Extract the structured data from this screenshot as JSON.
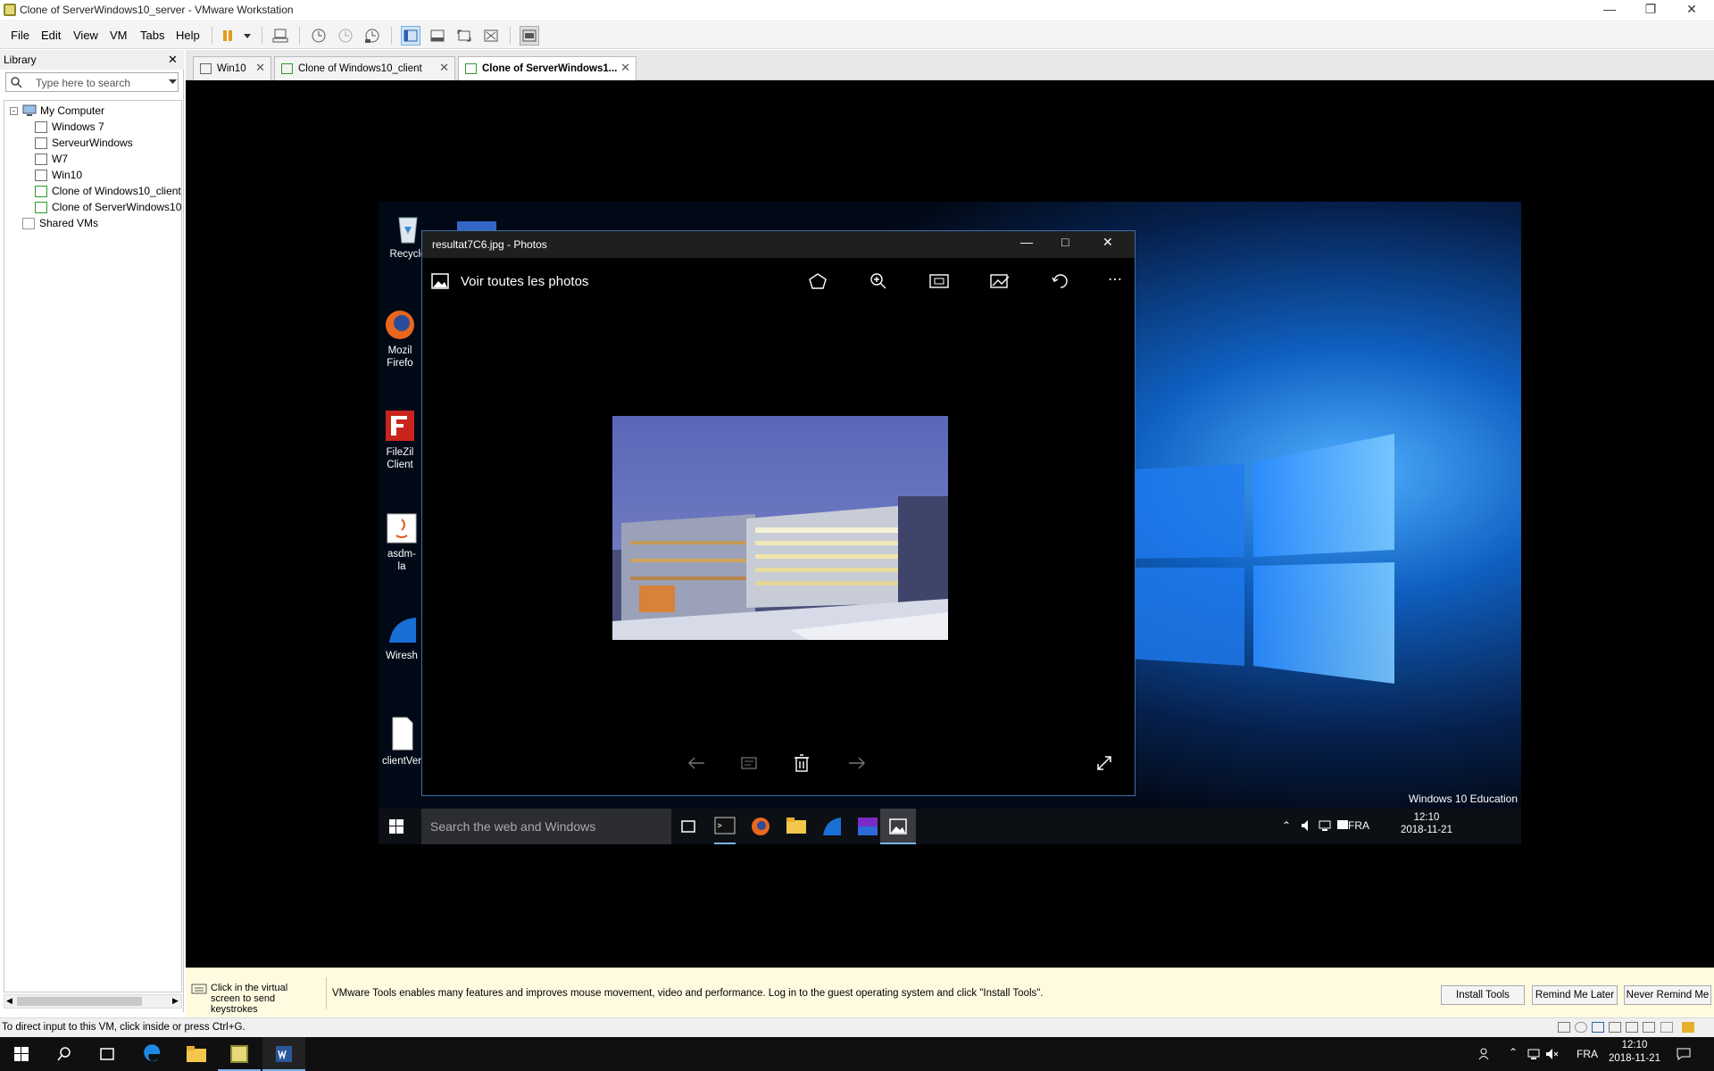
{
  "window": {
    "title": "Clone of ServerWindows10_server - VMware Workstation"
  },
  "menu": [
    "File",
    "Edit",
    "View",
    "VM",
    "Tabs",
    "Help"
  ],
  "library": {
    "title": "Library",
    "search_placeholder": "Type here to search",
    "root": "My Computer",
    "items": [
      "Windows 7",
      "ServeurWindows",
      "W7",
      "Win10",
      "Clone of Windows10_client",
      "Clone of ServerWindows10_server"
    ],
    "shared": "Shared VMs"
  },
  "tabs": [
    {
      "label": "Win10"
    },
    {
      "label": "Clone of Windows10_client"
    },
    {
      "label": "Clone of ServerWindows1..."
    }
  ],
  "guest": {
    "desktop_icons": [
      {
        "label": "Recycle"
      },
      {
        "label": "Mozil Firefo"
      },
      {
        "label": "FileZil Client"
      },
      {
        "label": "asdm-la"
      },
      {
        "label": "Wiresh"
      },
      {
        "label": "clientVer"
      }
    ],
    "photos": {
      "title": "resultat7C6.jpg - Photos",
      "back_label": "Voir toutes les photos"
    },
    "edition": "Windows 10 Education",
    "search_placeholder": "Search the web and Windows",
    "tray": {
      "lang": "FRA",
      "time": "12:10",
      "date": "2018-11-21"
    }
  },
  "notice": {
    "click_hint": "Click in the virtual screen to send keystrokes",
    "message": "VMware Tools enables many features and improves mouse movement, video and performance. Log in to the guest operating system and click \"Install Tools\".",
    "buttons": [
      "Install Tools",
      "Remind Me Later",
      "Never Remind Me"
    ]
  },
  "status": "To direct input to this VM, click inside or press Ctrl+G.",
  "host_tray": {
    "lang": "FRA",
    "time": "12:10",
    "date": "2018-11-21"
  },
  "colors": {
    "accent": "#0a78d7",
    "notice_bg": "#fffbe1",
    "win_blue": "#0b3d8a"
  }
}
